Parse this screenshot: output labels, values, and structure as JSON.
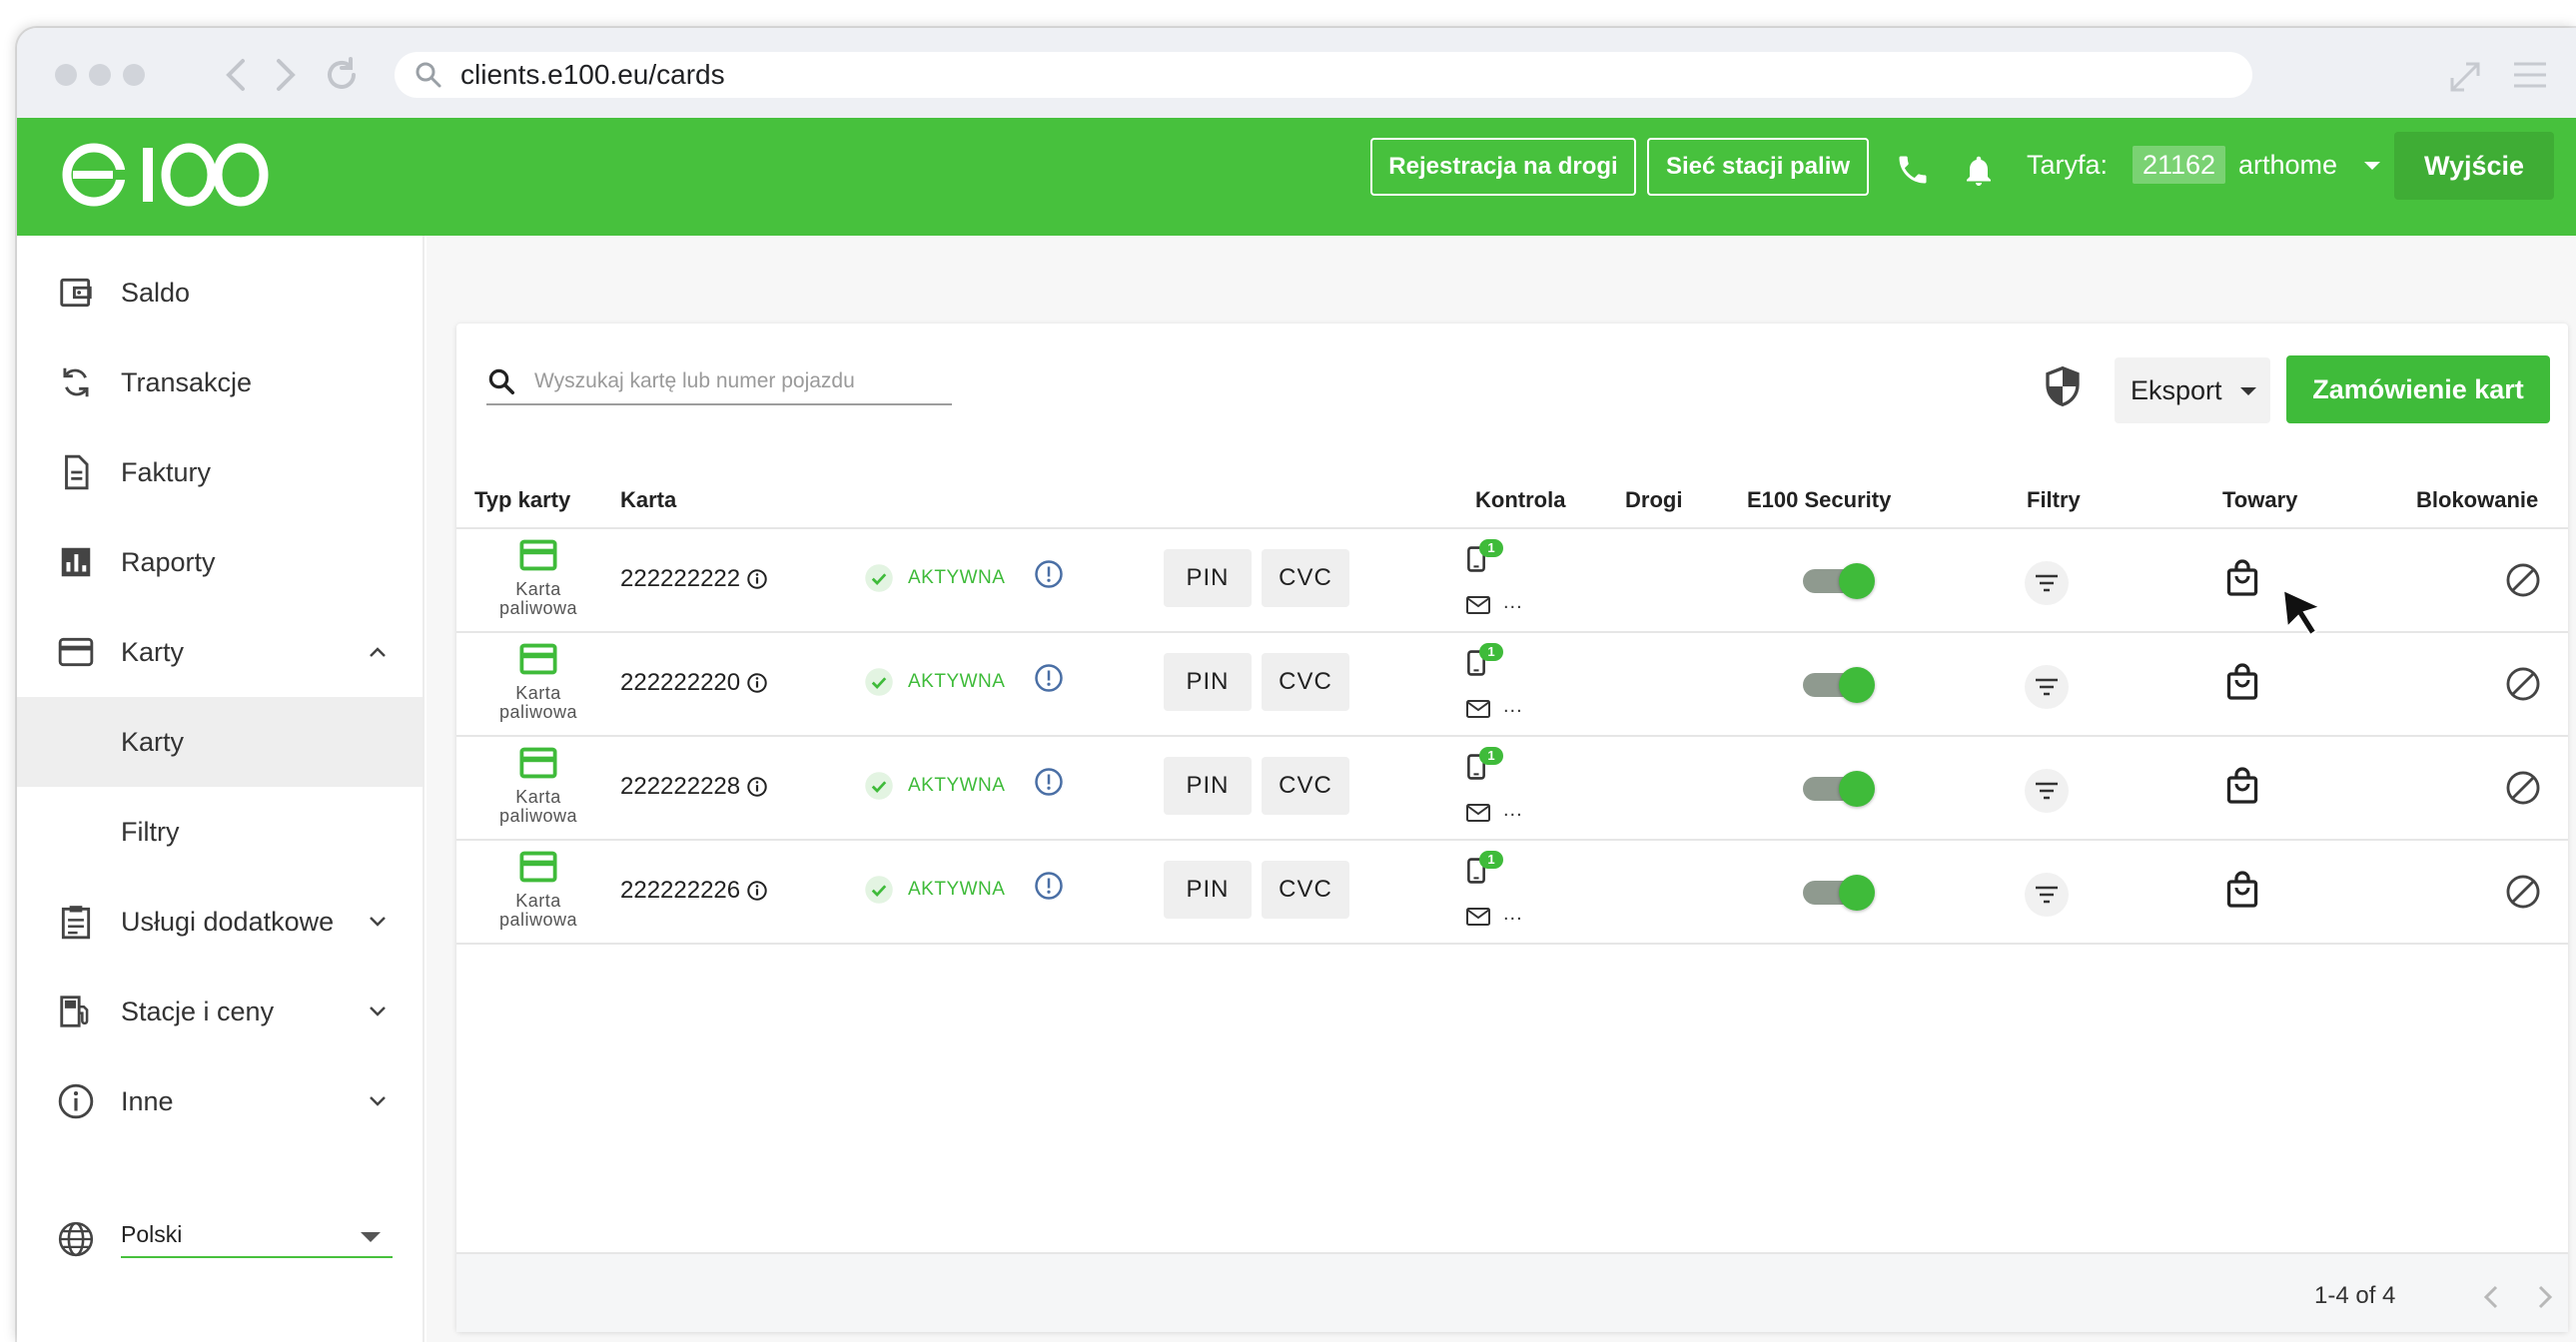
{
  "browser": {
    "url": "clients.e100.eu/cards"
  },
  "header": {
    "logo_text": "e100",
    "buttons": {
      "road_registration": "Rejestracja na drogi",
      "station_network": "Sieć stacji paliw"
    },
    "tariff_label": "Taryfa:",
    "tariff_value": "21162",
    "user_name": "arthome",
    "logout_label": "Wyjście"
  },
  "sidebar": {
    "items": [
      {
        "label": "Saldo",
        "icon": "wallet-icon"
      },
      {
        "label": "Transakcje",
        "icon": "refresh-icon"
      },
      {
        "label": "Faktury",
        "icon": "document-icon"
      },
      {
        "label": "Raporty",
        "icon": "chart-icon"
      },
      {
        "label": "Karty",
        "icon": "credit-card-icon"
      },
      {
        "label": "Karty"
      },
      {
        "label": "Filtry"
      },
      {
        "label": "Usługi dodatkowe",
        "icon": "clipboard-icon"
      },
      {
        "label": "Stacje i ceny",
        "icon": "fuel-station-icon"
      },
      {
        "label": "Inne",
        "icon": "info-icon"
      }
    ],
    "language": "Polski"
  },
  "toolbar": {
    "search_placeholder": "Wyszukaj kartę lub numer pojazdu",
    "export_label": "Eksport",
    "order_label": "Zamówienie kart"
  },
  "table": {
    "columns": [
      "Typ karty",
      "Karta",
      "Kontrola",
      "Drogi",
      "E100 Security",
      "Filtry",
      "Towary",
      "Blokowanie"
    ],
    "rows": [
      {
        "type_line1": "Karta",
        "type_line2": "paliwowa",
        "card": "222222222",
        "status": "AKTYWNA",
        "pin": "PIN",
        "cvc": "CVC",
        "badge": "1",
        "dots": "...",
        "security_on": true
      },
      {
        "type_line1": "Karta",
        "type_line2": "paliwowa",
        "card": "222222220",
        "status": "AKTYWNA",
        "pin": "PIN",
        "cvc": "CVC",
        "badge": "1",
        "dots": "...",
        "security_on": true
      },
      {
        "type_line1": "Karta",
        "type_line2": "paliwowa",
        "card": "222222228",
        "status": "AKTYWNA",
        "pin": "PIN",
        "cvc": "CVC",
        "badge": "1",
        "dots": "...",
        "security_on": true
      },
      {
        "type_line1": "Karta",
        "type_line2": "paliwowa",
        "card": "222222226",
        "status": "AKTYWNA",
        "pin": "PIN",
        "cvc": "CVC",
        "badge": "1",
        "dots": "...",
        "security_on": true
      }
    ]
  },
  "pagination": {
    "range_text": "1-4 of 4"
  },
  "colors": {
    "brand_green": "#47c13d",
    "button_green": "#3fbb3a",
    "status_green": "#3fbb3a"
  }
}
